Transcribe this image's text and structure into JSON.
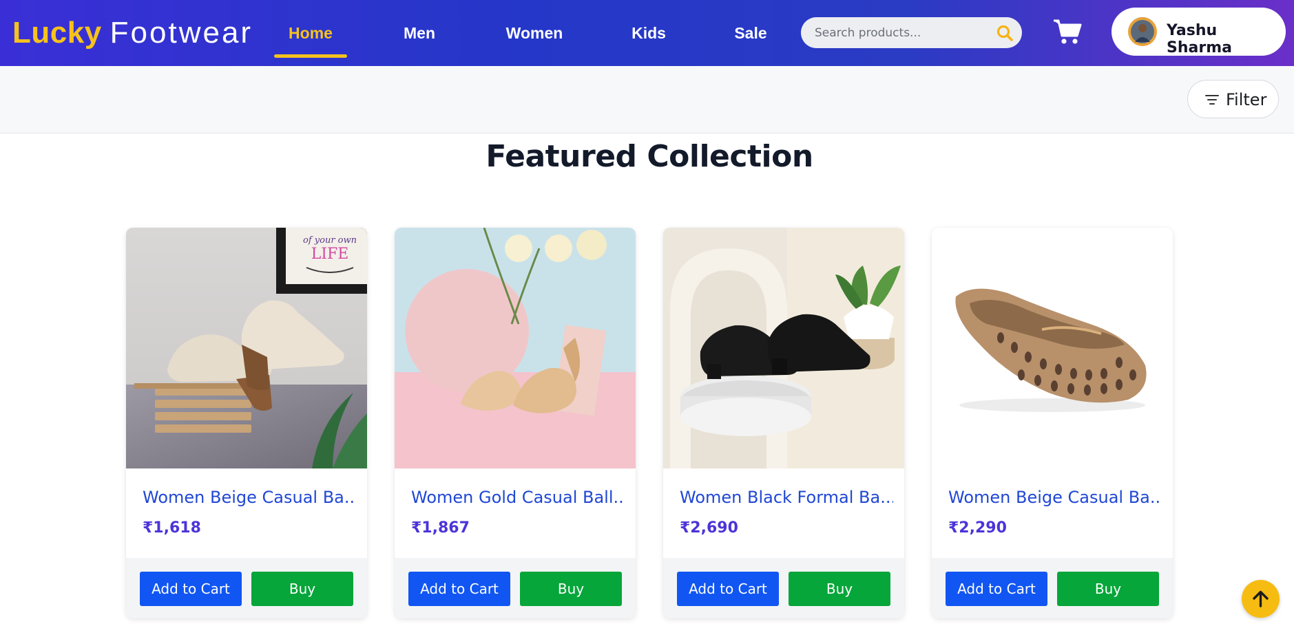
{
  "brand": {
    "part1": "Lucky",
    "part2": "Footwear"
  },
  "nav": {
    "items": [
      {
        "label": "Home",
        "active": true
      },
      {
        "label": "Men",
        "active": false
      },
      {
        "label": "Women",
        "active": false
      },
      {
        "label": "Kids",
        "active": false
      },
      {
        "label": "Sale",
        "active": false
      }
    ]
  },
  "search": {
    "placeholder": "Search products...",
    "value": ""
  },
  "user": {
    "name": "Yashu Sharma"
  },
  "filter": {
    "label": "Filter"
  },
  "section": {
    "title": "Featured Collection"
  },
  "products": [
    {
      "title": "Women Beige Casual Ba...",
      "price": "₹1,618",
      "add_label": "Add to Cart",
      "buy_label": "Buy"
    },
    {
      "title": "Women Gold Casual Ball...",
      "price": "₹1,867",
      "add_label": "Add to Cart",
      "buy_label": "Buy"
    },
    {
      "title": "Women Black Formal Ba...",
      "price": "₹2,690",
      "add_label": "Add to Cart",
      "buy_label": "Buy"
    },
    {
      "title": "Women Beige Casual Ba...",
      "price": "₹2,290",
      "add_label": "Add to Cart",
      "buy_label": "Buy"
    }
  ],
  "colors": {
    "accent": "#f6c21c",
    "add_to_cart": "#1156f2",
    "buy": "#06a63a",
    "product_title": "#2047d4",
    "price": "#4b34d8"
  },
  "icons": {
    "search": "search-icon",
    "cart": "cart-icon",
    "filter": "filter-icon",
    "scroll_top": "arrow-up-icon"
  },
  "decor": {
    "frame_text_1": "of your own",
    "frame_text_2": "LIFE"
  }
}
